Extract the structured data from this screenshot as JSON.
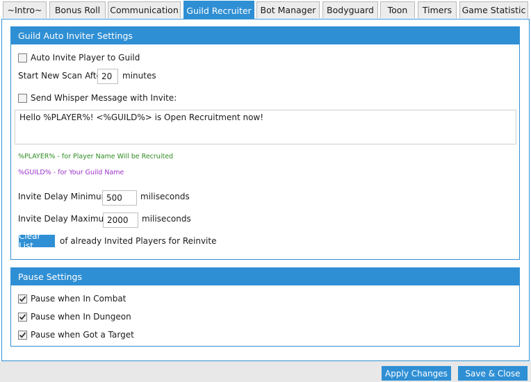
{
  "tabs": [
    {
      "label": "~Intro~"
    },
    {
      "label": "Bonus Roll"
    },
    {
      "label": "Communication"
    },
    {
      "label": "Guild Recruiter",
      "active": true
    },
    {
      "label": "Bot Manager"
    },
    {
      "label": "Bodyguard"
    },
    {
      "label": "Toon"
    },
    {
      "label": "Timers"
    },
    {
      "label": "Game Statistic"
    }
  ],
  "inviter": {
    "title": "Guild Auto Inviter Settings",
    "auto_invite_label": "Auto Invite Player to Guild",
    "auto_invite_checked": false,
    "scan_label": "Start New Scan After",
    "scan_value": "20",
    "scan_unit": "minutes",
    "whisper_label": "Send Whisper Message with Invite:",
    "whisper_checked": false,
    "message": "Hello %PLAYER%! <%GUILD%> is Open Recruitment now!",
    "hint_player": "%PLAYER% - for Player Name Will be Recruited",
    "hint_guild": "%GUILD% - for Your Guild Name",
    "delay_min_label": "Invite Delay Minimum",
    "delay_min_value": "500",
    "delay_min_unit": "miliseconds",
    "delay_max_label": "Invite Delay Maximum",
    "delay_max_value": "2000",
    "delay_max_unit": "miliseconds",
    "clear_button": "Clear List",
    "clear_desc": "of already Invited Players for Reinvite"
  },
  "pause": {
    "title": "Pause Settings",
    "items": [
      {
        "label": "Pause when In Combat",
        "checked": true
      },
      {
        "label": "Pause when In Dungeon",
        "checked": true
      },
      {
        "label": "Pause when Got a Target",
        "checked": true
      }
    ]
  },
  "footer": {
    "apply": "Apply Changes",
    "save": "Save & Close"
  },
  "colors": {
    "accent": "#2f8fd4",
    "hint_player": "#2e8b22",
    "hint_guild": "#9b30c8"
  }
}
